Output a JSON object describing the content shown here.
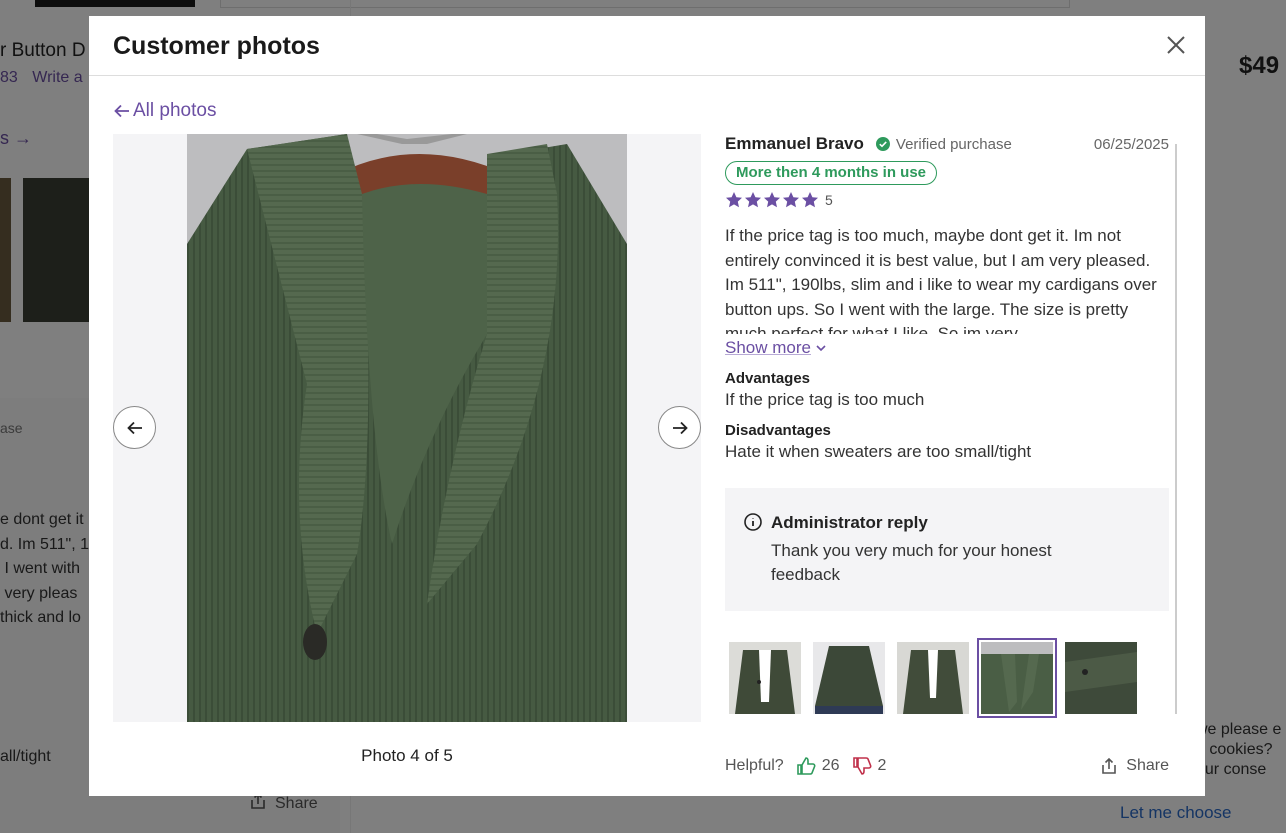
{
  "background": {
    "product_title": "r Button D",
    "review_count": "83",
    "write_review": "Write a",
    "price": "$49",
    "photos_link": "s",
    "purchase_label": "ase",
    "review_lines": "e dont get it\nd. Im 511\", 1\n I went with\n very pleas\nthick and lo",
    "disadvantage": "all/tight",
    "share_label": "Share",
    "cookie_text": "we please e\ne cookies?\nour conse",
    "cookie_link": "Let me choose"
  },
  "modal": {
    "title": "Customer photos",
    "back_link": "All photos",
    "photo_counter": "Photo 4 of 5",
    "review": {
      "author": "Emmanuel Bravo",
      "verified": "Verified purchase",
      "date": "06/25/2025",
      "usage_badge": "More then 4 months in use",
      "rating": "5",
      "text": "If the price tag is too much, maybe dont get it. Im not entirely convinced it is best value, but I am very pleased. Im 511\", 190lbs, slim and i like to wear my cardigans over button ups. So I went with the large. The size is pretty much perfect for what I like. So im very...",
      "show_more": "Show more",
      "advantages_title": "Advantages",
      "advantages_text": "If the price tag is too much",
      "disadvantages_title": "Disadvantages",
      "disadvantages_text": "Hate it when sweaters are too small/tight",
      "admin_title": "Administrator reply",
      "admin_text": "Thank you very much for your honest feedback"
    },
    "footer": {
      "helpful_label": "Helpful?",
      "upvotes": "26",
      "downvotes": "2",
      "share_label": "Share"
    }
  },
  "colors": {
    "accent": "#6b4fa3",
    "verified_green": "#2e9a5c",
    "sweater_green": "#4a5e45"
  }
}
